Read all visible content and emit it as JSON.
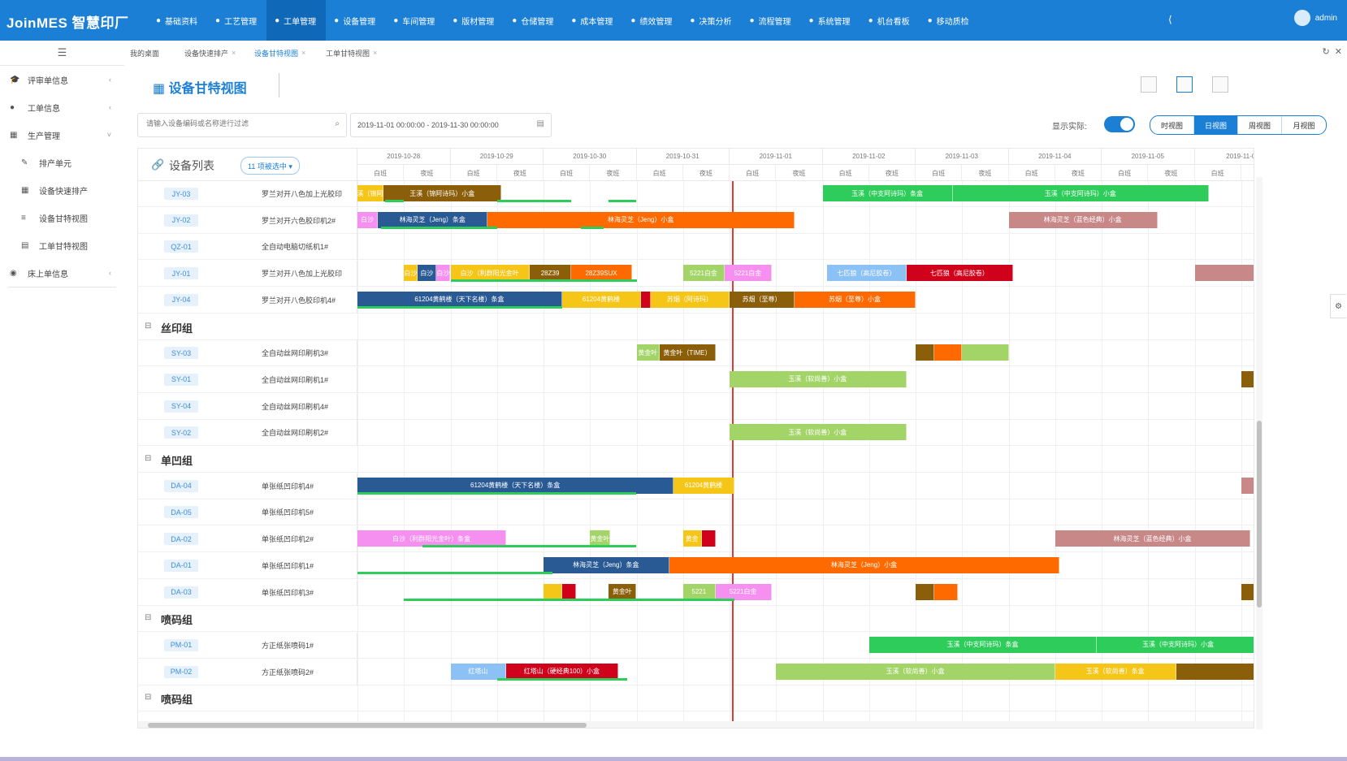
{
  "app": {
    "logo": "JoinMES 智慧印厂",
    "user": "admin",
    "more_icon": "collapse-icon"
  },
  "topnav": [
    {
      "label": "基础资料",
      "icon": "info-icon",
      "active": false
    },
    {
      "label": "工艺管理",
      "icon": "process-icon",
      "active": false
    },
    {
      "label": "工单管理",
      "icon": "order-icon",
      "active": true
    },
    {
      "label": "设备管理",
      "icon": "device-icon",
      "active": false
    },
    {
      "label": "车间管理",
      "icon": "workshop-icon",
      "active": false
    },
    {
      "label": "版材管理",
      "icon": "plate-icon",
      "active": false
    },
    {
      "label": "仓储管理",
      "icon": "storage-icon",
      "active": false
    },
    {
      "label": "成本管理",
      "icon": "cost-icon",
      "active": false
    },
    {
      "label": "绩效管理",
      "icon": "perf-icon",
      "active": false
    },
    {
      "label": "决策分析",
      "icon": "analysis-icon",
      "active": false
    },
    {
      "label": "流程管理",
      "icon": "flow-icon",
      "active": false
    },
    {
      "label": "系统管理",
      "icon": "system-icon",
      "active": false
    },
    {
      "label": "机台看板",
      "icon": "board-icon",
      "active": false
    },
    {
      "label": "移动质检",
      "icon": "mobile-icon",
      "active": false
    }
  ],
  "sidebar": {
    "items": [
      {
        "label": "评审单信息",
        "icon": "graduation-icon",
        "sub": false,
        "arrow": "‹"
      },
      {
        "label": "工单信息",
        "icon": "circle-icon",
        "sub": false,
        "arrow": "‹"
      },
      {
        "label": "生产管理",
        "icon": "calendar-icon",
        "sub": false,
        "arrow": "˅"
      },
      {
        "label": "排产单元",
        "icon": "edit-icon",
        "sub": true,
        "arrow": ""
      },
      {
        "label": "设备快速排产",
        "icon": "grid-icon",
        "sub": true,
        "arrow": ""
      },
      {
        "label": "设备甘特视图",
        "icon": "list-icon",
        "sub": true,
        "arrow": ""
      },
      {
        "label": "工单甘特视图",
        "icon": "table-icon",
        "sub": true,
        "arrow": ""
      },
      {
        "label": "床上单信息",
        "icon": "globe-icon",
        "sub": false,
        "arrow": "‹"
      }
    ]
  },
  "tabs": [
    {
      "label": "我的桌面",
      "closable": false,
      "active": false
    },
    {
      "label": "设备快速排产",
      "closable": true,
      "active": false
    },
    {
      "label": "设备甘特视图",
      "closable": true,
      "active": true
    },
    {
      "label": "工单甘特视图",
      "closable": true,
      "active": false
    }
  ],
  "page": {
    "title": "设备甘特视图",
    "title_icon": "gantt-icon"
  },
  "toolbar": {
    "search_placeholder": "请输入设备编码或名称进行过滤",
    "date_range": "2019-11-01 00:00:00 - 2019-11-30 00:00:00",
    "actual_label": "显示实际:",
    "actual_on": true,
    "views": [
      {
        "label": "时视图",
        "active": false
      },
      {
        "label": "日视图",
        "active": true
      },
      {
        "label": "周视图",
        "active": false
      },
      {
        "label": "月视图",
        "active": false
      }
    ]
  },
  "gantt": {
    "left_title": "设备列表",
    "filter_tag": "11 项被选中 ▾",
    "shifts": [
      "白班",
      "夜班"
    ],
    "dates": [
      "2019-10-28",
      "2019-10-29",
      "2019-10-30",
      "2019-10-31",
      "2019-11-01",
      "2019-11-02",
      "2019-11-03",
      "2019-11-04",
      "2019-11-05",
      "2019-11-0"
    ],
    "now_day": 4.03,
    "rows": [
      {
        "type": "device",
        "code": "JY-03",
        "name": "罗兰对开八色加上光胶印",
        "bars": [
          {
            "start": 0,
            "end": 0.28,
            "label": "王溪（锦阿诗",
            "color": "#f5c518"
          },
          {
            "start": 0.28,
            "end": 1.55,
            "label": "王溪（锦阿诗玛）小盒",
            "color": "#8b5e0a"
          },
          {
            "start": 5,
            "end": 6.4,
            "label": "玉溪（中支阿诗玛）条盒",
            "color": "#2ecc5b"
          },
          {
            "start": 6.4,
            "end": 9.15,
            "label": "玉溪（中支阿诗玛）小盒",
            "color": "#2ecc5b"
          }
        ],
        "actual": [
          {
            "start": 0.3,
            "end": 0.5
          },
          {
            "start": 1.5,
            "end": 2.3
          },
          {
            "start": 2.7,
            "end": 3.0
          }
        ]
      },
      {
        "type": "device",
        "code": "JY-02",
        "name": "罗兰对开六色胶印机2#",
        "bars": [
          {
            "start": 0,
            "end": 0.22,
            "label": "白沙",
            "color": "#f590f0"
          },
          {
            "start": 0.22,
            "end": 1.4,
            "label": "林海灵芝（Jeng）条盒",
            "color": "#2a5a94"
          },
          {
            "start": 1.4,
            "end": 4.7,
            "label": "林海灵芝（Jeng）小盒",
            "color": "#ff6a00"
          },
          {
            "start": 7,
            "end": 8.6,
            "label": "林海灵芝（蓝色经典）小盒",
            "color": "#c98888"
          }
        ],
        "actual": [
          {
            "start": 0.25,
            "end": 1.5
          },
          {
            "start": 2.4,
            "end": 2.65
          }
        ]
      },
      {
        "type": "device",
        "code": "QZ-01",
        "name": "全自动电脑切纸机1#",
        "bars": [],
        "actual": []
      },
      {
        "type": "device",
        "code": "JY-01",
        "name": "罗兰对开八色加上光胶印",
        "bars": [
          {
            "start": 0.5,
            "end": 0.65,
            "label": "白沙",
            "color": "#f5c518"
          },
          {
            "start": 0.65,
            "end": 0.85,
            "label": "白沙",
            "color": "#2a5a94"
          },
          {
            "start": 0.85,
            "end": 1.0,
            "label": "白沙",
            "color": "#f590f0"
          },
          {
            "start": 1.0,
            "end": 1.85,
            "label": "白沙（利群阳光金叶",
            "color": "#f5c518"
          },
          {
            "start": 1.85,
            "end": 2.3,
            "label": "28Z39",
            "color": "#8b5e0a"
          },
          {
            "start": 2.3,
            "end": 2.95,
            "label": "28Z39SUX",
            "color": "#ff6a00"
          },
          {
            "start": 3.5,
            "end": 3.95,
            "label": "5221白金",
            "color": "#a3d468"
          },
          {
            "start": 3.95,
            "end": 4.45,
            "label": "5221白金",
            "color": "#f590f0"
          },
          {
            "start": 5.05,
            "end": 5.9,
            "label": "七匹狼（高尼胶卷）",
            "color": "#8cc1f5"
          },
          {
            "start": 5.9,
            "end": 7.05,
            "label": "七匹狼（高尼胶卷）",
            "color": "#d0021b"
          },
          {
            "start": 9.0,
            "end": 9.7,
            "label": "",
            "color": "#c98888"
          }
        ],
        "actual": [
          {
            "start": 1.0,
            "end": 3.0
          }
        ]
      },
      {
        "type": "device",
        "code": "JY-04",
        "name": "罗兰对开八色胶印机4#",
        "bars": [
          {
            "start": 0,
            "end": 2.2,
            "label": "61204黄鹤楼（天下名楼）条盒",
            "color": "#2a5a94"
          },
          {
            "start": 2.2,
            "end": 3.05,
            "label": "61204黄鹤楼",
            "color": "#f5c518"
          },
          {
            "start": 3.05,
            "end": 3.15,
            "label": "",
            "color": "#d0021b"
          },
          {
            "start": 3.15,
            "end": 4.0,
            "label": "苏烟（阿诗玛）",
            "color": "#f5c518"
          },
          {
            "start": 4.0,
            "end": 4.7,
            "label": "苏烟（至尊）",
            "color": "#8b5e0a"
          },
          {
            "start": 4.7,
            "end": 6.0,
            "label": "苏烟（至尊）小盒",
            "color": "#ff6a00"
          }
        ],
        "actual": [
          {
            "start": 0,
            "end": 2.2
          }
        ]
      },
      {
        "type": "group",
        "name": "丝印组"
      },
      {
        "type": "device",
        "code": "SY-03",
        "name": "全自动丝网印刷机3#",
        "bars": [
          {
            "start": 3.0,
            "end": 3.25,
            "label": "黄金叶",
            "color": "#a3d468"
          },
          {
            "start": 3.25,
            "end": 3.85,
            "label": "黄金叶（TIME）",
            "color": "#8b5e0a"
          },
          {
            "start": 6.0,
            "end": 6.2,
            "label": "",
            "color": "#8b5e0a"
          },
          {
            "start": 6.2,
            "end": 6.5,
            "label": "",
            "color": "#ff6a00"
          },
          {
            "start": 6.5,
            "end": 7.0,
            "label": "",
            "color": "#a3d468"
          }
        ],
        "actual": []
      },
      {
        "type": "device",
        "code": "SY-01",
        "name": "全自动丝网印刷机1#",
        "bars": [
          {
            "start": 4.0,
            "end": 5.9,
            "label": "玉溪（软尚善）小盒",
            "color": "#a3d468"
          },
          {
            "start": 9.5,
            "end": 9.7,
            "label": "",
            "color": "#8b5e0a"
          }
        ],
        "actual": []
      },
      {
        "type": "device",
        "code": "SY-04",
        "name": "全自动丝网印刷机4#",
        "bars": [],
        "actual": []
      },
      {
        "type": "device",
        "code": "SY-02",
        "name": "全自动丝网印刷机2#",
        "bars": [
          {
            "start": 4.0,
            "end": 5.9,
            "label": "玉溪（软尚善）小盒",
            "color": "#a3d468"
          }
        ],
        "actual": []
      },
      {
        "type": "group",
        "name": "单凹组"
      },
      {
        "type": "device",
        "code": "DA-04",
        "name": "单张纸凹印机4#",
        "bars": [
          {
            "start": 0,
            "end": 3.4,
            "label": "61204黄鹤楼（天下名楼）条盒",
            "color": "#2a5a94"
          },
          {
            "start": 3.4,
            "end": 4.05,
            "label": "61204黄鹤楼",
            "color": "#f5c518"
          },
          {
            "start": 9.5,
            "end": 9.7,
            "label": "",
            "color": "#c98888"
          }
        ],
        "actual": [
          {
            "start": 0,
            "end": 0.9
          },
          {
            "start": 0.9,
            "end": 3.0
          }
        ]
      },
      {
        "type": "device",
        "code": "DA-05",
        "name": "单张纸凹印机5#",
        "bars": [],
        "actual": []
      },
      {
        "type": "device",
        "code": "DA-02",
        "name": "单张纸凹印机2#",
        "bars": [
          {
            "start": 0,
            "end": 1.6,
            "label": "白沙（利群阳光金叶）条盒",
            "color": "#f590f0"
          },
          {
            "start": 2.5,
            "end": 2.72,
            "label": "黄金叶",
            "color": "#a3d468"
          },
          {
            "start": 3.5,
            "end": 3.7,
            "label": "黄金",
            "color": "#f5c518"
          },
          {
            "start": 3.7,
            "end": 3.85,
            "label": "",
            "color": "#d0021b"
          },
          {
            "start": 7.5,
            "end": 9.6,
            "label": "林海灵芝（蓝色经典）小盒",
            "color": "#c98888"
          }
        ],
        "actual": [
          {
            "start": 0.7,
            "end": 3.0
          }
        ]
      },
      {
        "type": "device",
        "code": "DA-01",
        "name": "单张纸凹印机1#",
        "bars": [
          {
            "start": 2.0,
            "end": 3.35,
            "label": "林海灵芝（Jeng）条盒",
            "color": "#2a5a94"
          },
          {
            "start": 3.35,
            "end": 7.55,
            "label": "林海灵芝（Jeng）小盒",
            "color": "#ff6a00"
          }
        ],
        "actual": [
          {
            "start": 0,
            "end": 2.1
          }
        ]
      },
      {
        "type": "device",
        "code": "DA-03",
        "name": "单张纸凹印机3#",
        "bars": [
          {
            "start": 2.0,
            "end": 2.2,
            "label": "",
            "color": "#f5c518"
          },
          {
            "start": 2.2,
            "end": 2.35,
            "label": "",
            "color": "#d0021b"
          },
          {
            "start": 2.7,
            "end": 3.0,
            "label": "黄金叶",
            "color": "#8b5e0a"
          },
          {
            "start": 3.5,
            "end": 3.85,
            "label": "5221",
            "color": "#a3d468"
          },
          {
            "start": 3.85,
            "end": 4.45,
            "label": "5221白金",
            "color": "#f590f0"
          },
          {
            "start": 6.0,
            "end": 6.2,
            "label": "",
            "color": "#8b5e0a"
          },
          {
            "start": 6.2,
            "end": 6.45,
            "label": "",
            "color": "#ff6a00"
          },
          {
            "start": 9.5,
            "end": 9.7,
            "label": "",
            "color": "#8b5e0a"
          }
        ],
        "actual": [
          {
            "start": 0.5,
            "end": 4.05
          }
        ]
      },
      {
        "type": "group",
        "name": "喷码组"
      },
      {
        "type": "device",
        "code": "PM-01",
        "name": "方正纸张喷码1#",
        "bars": [
          {
            "start": 5.5,
            "end": 7.95,
            "label": "玉溪（中支阿诗玛）条盒",
            "color": "#2ecc5b"
          },
          {
            "start": 7.95,
            "end": 9.7,
            "label": "玉溪（中支阿诗玛）小盒",
            "color": "#2ecc5b"
          }
        ],
        "actual": []
      },
      {
        "type": "device",
        "code": "PM-02",
        "name": "方正纸张喷码2#",
        "bars": [
          {
            "start": 1.0,
            "end": 1.6,
            "label": "红塔山",
            "color": "#8cc1f5"
          },
          {
            "start": 1.6,
            "end": 2.8,
            "label": "红塔山（硬经典100）小盒",
            "color": "#d0021b"
          },
          {
            "start": 4.5,
            "end": 7.5,
            "label": "玉溪（软尚善）小盒",
            "color": "#a3d468"
          },
          {
            "start": 7.5,
            "end": 8.8,
            "label": "玉溪（软尚善）条盒",
            "color": "#f5c518"
          },
          {
            "start": 8.8,
            "end": 9.7,
            "label": "",
            "color": "#8b5e0a"
          }
        ],
        "actual": [
          {
            "start": 1.5,
            "end": 2.8
          },
          {
            "start": 2.5,
            "end": 2.9
          }
        ]
      },
      {
        "type": "group",
        "name": "喷码组"
      }
    ]
  }
}
